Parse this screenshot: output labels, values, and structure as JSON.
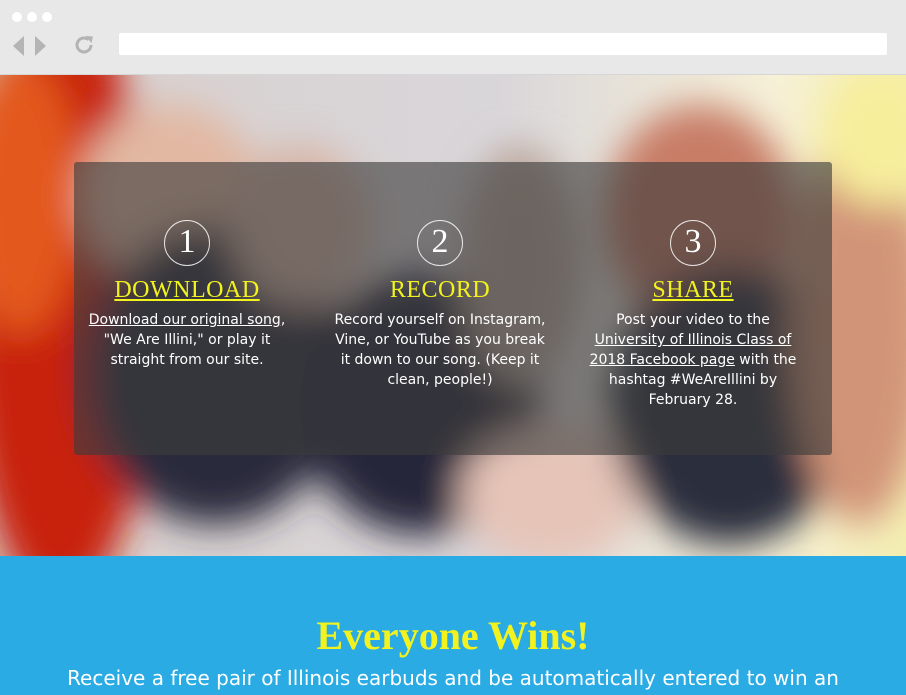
{
  "browser": {
    "url": ""
  },
  "steps": [
    {
      "number": "1",
      "title": "DOWNLOAD",
      "link_text": "Download our original song",
      "text": ", \"We Are Illini,\" or play it straight from our site."
    },
    {
      "number": "2",
      "title": "RECORD",
      "text": "Record yourself on Instagram, Vine, or YouTube as you break it down to our song. (Keep it clean, people!)"
    },
    {
      "number": "3",
      "title": "SHARE",
      "text_before": "Post your video to the ",
      "link_text": "University of Illinois Class of 2018 Facebook page",
      "text_after": " with the hashtag #WeAreIllini by February 28."
    }
  ],
  "wins": {
    "title": "Everyone Wins!",
    "text": "Receive a free pair of Illinois earbuds and be automatically entered to win an"
  },
  "colors": {
    "accent_yellow": "#f2f21e",
    "section_blue": "#2aabe4",
    "panel": "rgba(60,60,60,0.62)"
  }
}
